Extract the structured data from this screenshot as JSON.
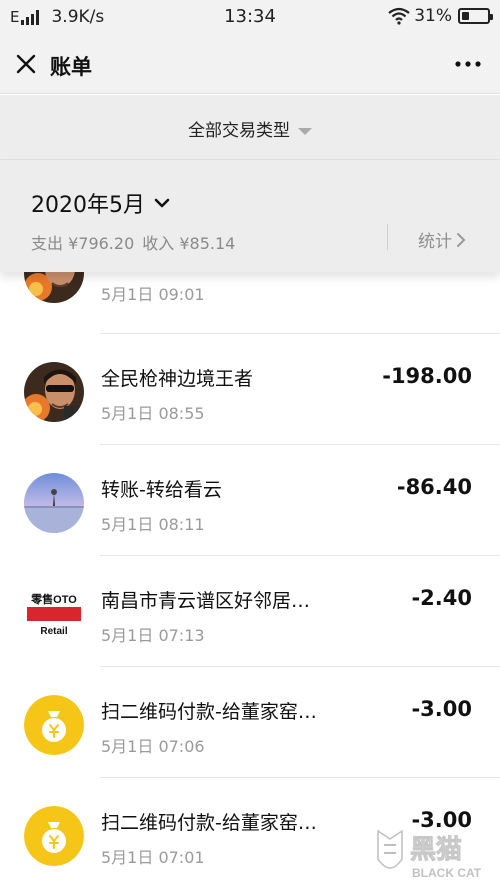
{
  "status_bar": {
    "network": "E",
    "speed": "3.9K/s",
    "time": "13:34",
    "battery": "31%",
    "battery_level": 0.31
  },
  "header": {
    "title": "账单"
  },
  "filter": {
    "label": "全部交易类型"
  },
  "summary": {
    "month": "2020年5月",
    "expense": "支出 ¥796.20",
    "income": "收入 ¥85.14",
    "stats_label": "统计"
  },
  "transactions": [
    {
      "name": "",
      "time": "5月1日 09:01",
      "amount": "",
      "avatar": "game-avatar"
    },
    {
      "name": "全民枪神边境王者",
      "time": "5月1日 08:55",
      "amount": "-198.00",
      "avatar": "game-avatar"
    },
    {
      "name": "转账-转给看云",
      "time": "5月1日 08:11",
      "amount": "-86.40",
      "avatar": "sunset-avatar"
    },
    {
      "name": "南昌市青云谱区好邻居…",
      "time": "5月1日 07:13",
      "amount": "-2.40",
      "avatar": "store-logo"
    },
    {
      "name": "扫二维码付款-给董家窑…",
      "time": "5月1日 07:06",
      "amount": "-3.00",
      "avatar": "money-bag-icon"
    },
    {
      "name": "扫二维码付款-给董家窑…",
      "time": "5月1日 07:01",
      "amount": "-3.00",
      "avatar": "money-bag-icon"
    }
  ],
  "store_logo": {
    "line1": "零售OTO",
    "line2": "Retail"
  },
  "watermark": {
    "text": "黑猫",
    "subtext": "BLACK CAT"
  },
  "colors": {
    "money_bag": "#f5c518",
    "background": "#ededed"
  }
}
